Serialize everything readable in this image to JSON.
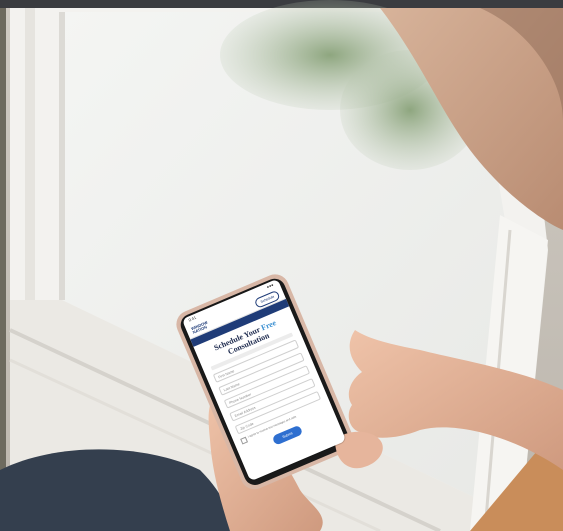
{
  "scene": {
    "description_colors": {
      "window_frame": "#f2f1ee",
      "glass": "#eef0ee",
      "foliage": "#7d9571",
      "skin": "#e3b49a",
      "jeans": "#343f4e",
      "phone_bezel": "#1a1a1a",
      "phone_case": "#d8b7a6",
      "brand_blue": "#1f3c78",
      "accent_blue": "#3a8fd1",
      "button_blue": "#2e6fd0"
    }
  },
  "phone": {
    "status": {
      "time": "9:41",
      "signal": "●●●"
    },
    "nav": {
      "logo": "WINDOW NATION",
      "button": "Schedule"
    },
    "form": {
      "title_line1": "Schedule Your",
      "title_accent": "Free",
      "title_line2": "Consultation",
      "fields": [
        "First Name",
        "Last Name",
        "Phone Number",
        "Email Address",
        "Zip Code"
      ],
      "consent": "I agree to receive text messages and calls",
      "submit": "Submit"
    }
  }
}
